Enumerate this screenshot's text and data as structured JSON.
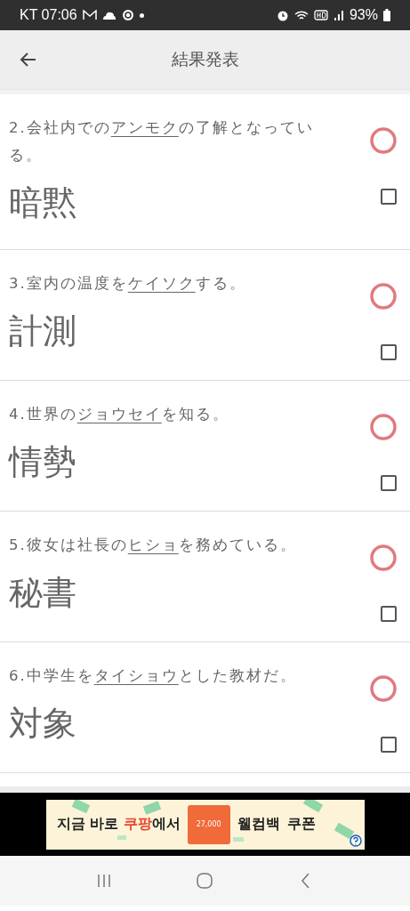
{
  "status_bar": {
    "carrier_time": "KT 07:06",
    "battery": "93%"
  },
  "app_bar": {
    "title": "結果発表"
  },
  "questions": [
    {
      "before": "2.会社内での",
      "underlined": "アンモク",
      "after": "の了解となっている。",
      "answer": "暗黙",
      "kind": "correct",
      "checked": false
    },
    {
      "before": "3.室内の温度を",
      "underlined": "ケイソク",
      "after": "する。",
      "answer": "計測",
      "kind": "correct",
      "checked": false
    },
    {
      "before": "4.世界の",
      "underlined": "ジョウセイ",
      "after": "を知る。",
      "answer": "情勢",
      "kind": "correct",
      "checked": false
    },
    {
      "before": "5.彼女は社長の",
      "underlined": "ヒショ",
      "after": "を務めている。",
      "answer": "秘書",
      "kind": "correct",
      "checked": false
    },
    {
      "before": "6.中学生を",
      "underlined": "タイショウ",
      "after": "とした教材だ。",
      "answer": "対象",
      "kind": "correct",
      "checked": false
    }
  ],
  "ad": {
    "lead": "지금 바로 ",
    "brand": "쿠팡",
    "tail": "에서",
    "coupon_amount": "27,000",
    "headline": "웰컴백",
    "headline_tail": "쿠폰"
  }
}
